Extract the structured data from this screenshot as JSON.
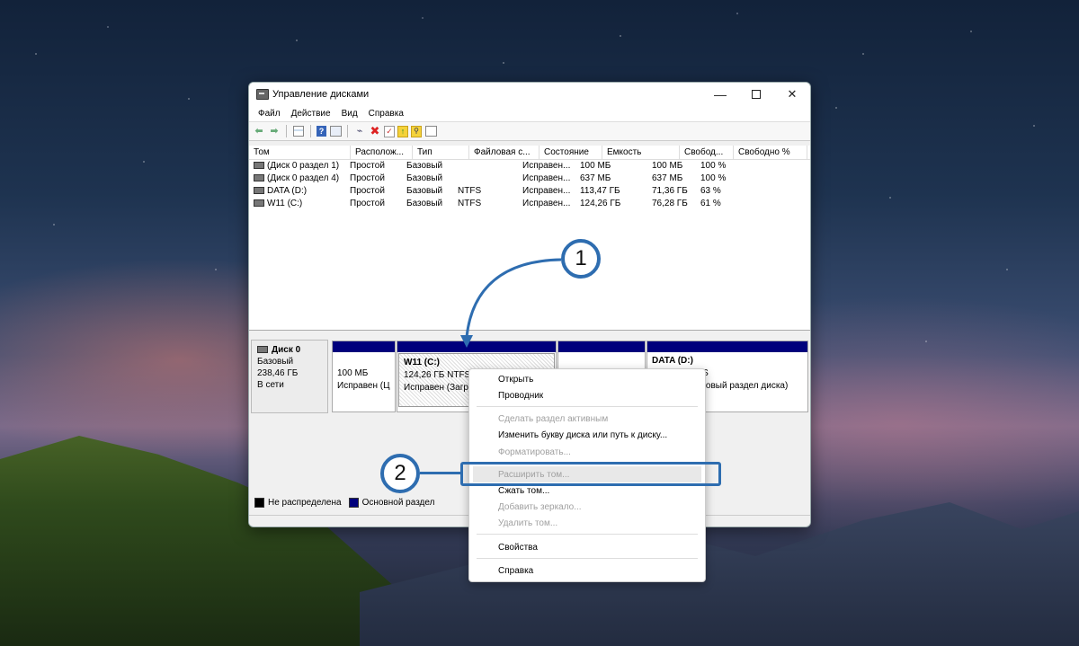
{
  "window": {
    "title": "Управление дисками",
    "controls": {
      "minimize": "—",
      "close": "✕"
    }
  },
  "menu": [
    "Файл",
    "Действие",
    "Вид",
    "Справка"
  ],
  "toolbar": {
    "icons": [
      "back-arrow-icon",
      "forward-arrow-icon",
      "console-grid-icon",
      "help-icon",
      "properties-icon",
      "connect-icon",
      "delete-icon",
      "check-icon",
      "upload-icon",
      "find-icon",
      "list-icon"
    ]
  },
  "volume_table": {
    "columns": [
      "Том",
      "Располож...",
      "Тип",
      "Файловая с...",
      "Состояние",
      "Емкость",
      "Свобод...",
      "Свободно %"
    ],
    "rows": [
      [
        "(Диск 0 раздел 1)",
        "Простой",
        "Базовый",
        "",
        "Исправен...",
        "100 МБ",
        "100 МБ",
        "100 %"
      ],
      [
        "(Диск 0 раздел 4)",
        "Простой",
        "Базовый",
        "",
        "Исправен...",
        "637 МБ",
        "637 МБ",
        "100 %"
      ],
      [
        "DATA (D:)",
        "Простой",
        "Базовый",
        "NTFS",
        "Исправен...",
        "113,47 ГБ",
        "71,36 ГБ",
        "63 %"
      ],
      [
        "W11 (C:)",
        "Простой",
        "Базовый",
        "NTFS",
        "Исправен...",
        "124,26 ГБ",
        "76,28 ГБ",
        "61 %"
      ]
    ]
  },
  "disk": {
    "name": "Диск 0",
    "type": "Базовый",
    "size": "238,46 ГБ",
    "status": "В сети",
    "partitions": [
      {
        "name": "",
        "size": "100 МБ",
        "status": "Исправен (Ц"
      },
      {
        "name": "W11  (C:)",
        "size": "124,26 ГБ NTFS",
        "status": "Исправен (Загру"
      },
      {
        "name": "",
        "size": "",
        "status": ""
      },
      {
        "name": "DATA  (D:)",
        "size": "FS",
        "status": "азовый раздел диска)"
      }
    ]
  },
  "legend": [
    {
      "label": "Не распределена",
      "color": "#000000"
    },
    {
      "label": "Основной раздел",
      "color": "#00007c"
    }
  ],
  "context_menu": {
    "items": [
      {
        "label": "Открыть",
        "enabled": true
      },
      {
        "label": "Проводник",
        "enabled": true
      },
      {
        "label": "Сделать раздел активным",
        "enabled": false
      },
      {
        "label": "Изменить букву диска или путь к диску...",
        "enabled": true
      },
      {
        "label": "Форматировать...",
        "enabled": false
      },
      {
        "label": "Расширить том...",
        "enabled": false
      },
      {
        "label": "Сжать том...",
        "enabled": true
      },
      {
        "label": "Добавить зеркало...",
        "enabled": false
      },
      {
        "label": "Удалить том...",
        "enabled": false
      },
      {
        "label": "Свойства",
        "enabled": true
      },
      {
        "label": "Справка",
        "enabled": true
      }
    ]
  },
  "callouts": [
    {
      "number": "1"
    },
    {
      "number": "2"
    }
  ],
  "colors": {
    "accent": "#2e6db0",
    "partition_bar": "#00007c"
  }
}
